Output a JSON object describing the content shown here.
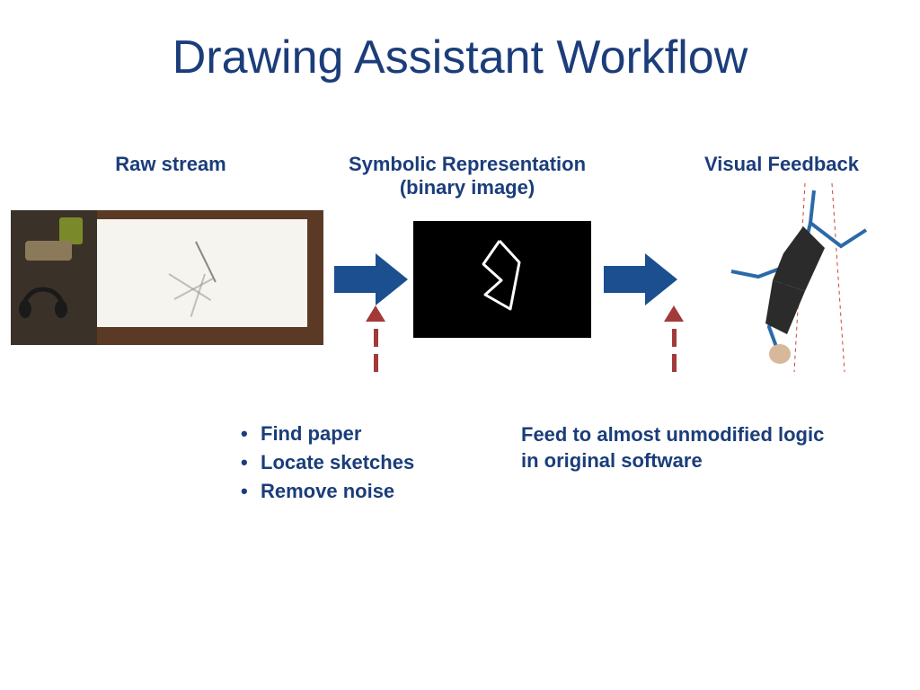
{
  "title": "Drawing Assistant Workflow",
  "labels": {
    "raw": "Raw stream",
    "symbolic_line1": "Symbolic Representation",
    "symbolic_line2": "(binary image)",
    "visual": "Visual Feedback"
  },
  "notes": {
    "left_items": [
      "Find paper",
      "Locate sketches",
      "Remove noise"
    ],
    "right": "Feed to almost unmodified logic in original software"
  },
  "colors": {
    "heading": "#1b3d7a",
    "arrow_fill": "#1b4f8f",
    "dashed_arrow": "#a23a3a"
  }
}
